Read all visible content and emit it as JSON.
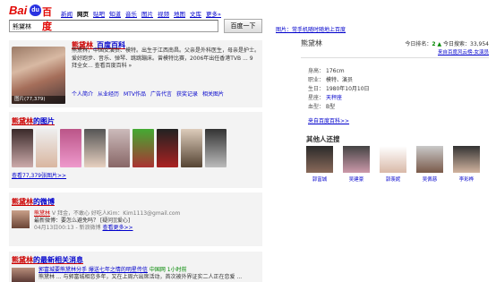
{
  "header": {
    "logo": {
      "bai": "Bai",
      "paw": "du",
      "du": "百度"
    },
    "nav": [
      {
        "label": "新闻",
        "active": false
      },
      {
        "label": "网页",
        "active": true
      },
      {
        "label": "贴吧",
        "active": false
      },
      {
        "label": "知道",
        "active": false
      },
      {
        "label": "音乐",
        "active": false
      },
      {
        "label": "图片",
        "active": false
      },
      {
        "label": "视频",
        "active": false
      },
      {
        "label": "地图",
        "active": false
      },
      {
        "label": "文库",
        "active": false
      },
      {
        "label": "更多»",
        "active": false
      }
    ],
    "search": {
      "value": "熊黛林",
      "button": "百度一下"
    }
  },
  "baike": {
    "title_red": "熊黛林",
    "title_blue": "_百度百科",
    "photo_count": "图片(77,379)",
    "desc": "熊黛林，中国女演员、模特。出生于江西南昌。父亲是外科医生，母亲是护士。爱好跑步、音乐、弹琴、跳跳蹦床。曾模特比赛，2006年出任香港TVB ... 9 拜全女... 查看百度百科 »",
    "links": [
      "个人简介",
      "从业经历",
      "MTV作品",
      "广告代言",
      "获奖记录",
      "相关图片"
    ]
  },
  "images": {
    "title_red": "熊黛林",
    "title_blue": "的图片",
    "more": "查看77,379张图片>>"
  },
  "weibo": {
    "title_red": "熊黛林",
    "title_blue": "的微博",
    "author": "熊黛林",
    "meta": "V 拜金，不敢心 好吃人Kim：Kim1113@gmail.com",
    "text": "最新微博：要怎么避免吗？ [疑问][爱心]",
    "time": "04月13日00:13 - 新浪微博",
    "more": "查看更多>>"
  },
  "news": {
    "title_red": "熊黛林",
    "title_blue": "的最新相关消息",
    "line1": "郭富城要熊黛林分手 爆送七年之情的明星传信",
    "source": "中国网 1小时前",
    "line2": "熊黛林 ... 与郭富城相恋多年，又在上周六出席活动，首次被外界证实二人正在恋爱 ..."
  },
  "right": {
    "toplink": "图片：常手机随时随地上百度",
    "name": "熊黛林",
    "rank_label": "今日排名：",
    "rank": "2",
    "search_label": "今日搜索：",
    "search_count": "33,954",
    "pair": "来自百度风云榜-女演员",
    "info": [
      {
        "k": "身高：",
        "v": "176cm"
      },
      {
        "k": "职业：",
        "v": "模特、演员"
      },
      {
        "k": "生日：",
        "v": "1980年10月10日"
      },
      {
        "k": "星座：",
        "v": "天秤座"
      },
      {
        "k": "血型：",
        "v": "B型"
      }
    ],
    "source": "来自百度百科>>",
    "also_title": "其他人还搜",
    "people": [
      "郭富城",
      "吴建豪",
      "郭羡妮",
      "吴佩慈",
      "李彩桦"
    ]
  }
}
